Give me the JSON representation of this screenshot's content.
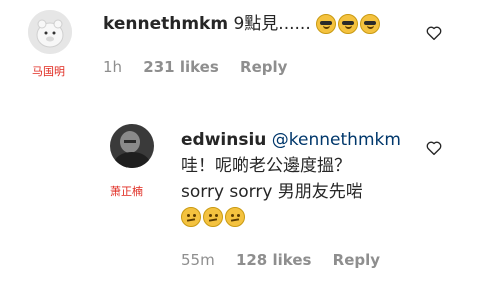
{
  "comment1": {
    "username": "kennethmkm",
    "text": "9點見......",
    "emoji": [
      "cool-emoji",
      "cool-emoji",
      "cool-emoji"
    ],
    "caption": "马国明",
    "time": "1h",
    "likes": "231 likes",
    "reply": "Reply"
  },
  "comment2": {
    "username": "edwinsiu",
    "mention": "@kennethmkm",
    "line1": "哇！呢啲老公邊度搵？",
    "line2": "sorry sorry 男朋友先啱",
    "emoji": [
      "thinking-emoji",
      "thinking-emoji",
      "thinking-emoji"
    ],
    "caption": "萧正楠",
    "time": "55m",
    "likes": "128 likes",
    "reply": "Reply"
  },
  "icons": {
    "like": "heart-outline-icon"
  },
  "colors": {
    "caption_red": "#e02a20",
    "meta_gray": "#8e8e8e",
    "mention_blue": "#00376b"
  }
}
